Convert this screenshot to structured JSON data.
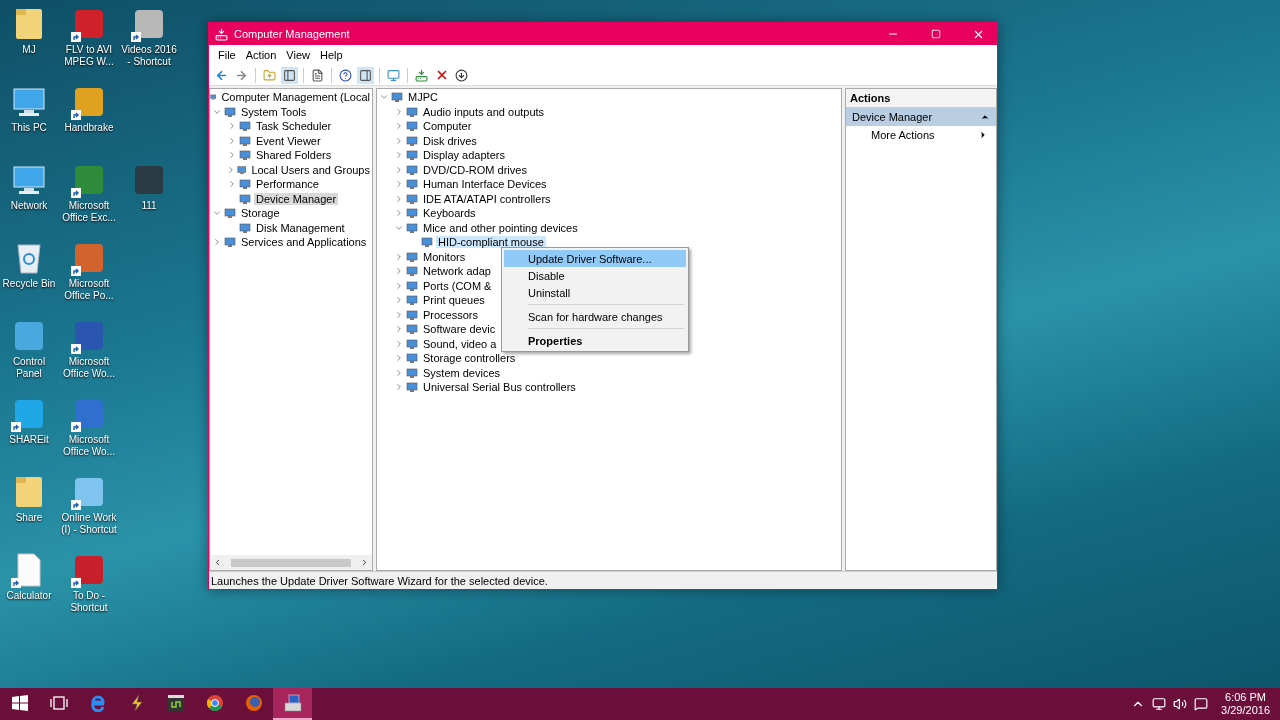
{
  "desktop": {
    "columns": [
      [
        {
          "label": "MJ",
          "kind": "folder",
          "shortcut": false
        },
        {
          "label": "This PC",
          "kind": "monitor",
          "shortcut": false
        },
        {
          "label": "Network",
          "kind": "monitor",
          "shortcut": false
        },
        {
          "label": "Recycle Bin",
          "kind": "bin",
          "shortcut": false
        },
        {
          "label": "Control Panel",
          "kind": "tile",
          "color": "#4aa8e0",
          "shortcut": false
        },
        {
          "label": "SHAREit",
          "kind": "tile",
          "color": "#1fa7e8",
          "shortcut": true
        },
        {
          "label": "Share",
          "kind": "folder",
          "shortcut": false
        },
        {
          "label": "Calculator",
          "kind": "document",
          "shortcut": true
        }
      ],
      [
        {
          "label": "FLV to AVI MPEG W...",
          "kind": "tile",
          "color": "#d0202a",
          "shortcut": true
        },
        {
          "label": "Handbrake",
          "kind": "tile",
          "color": "#e0a020",
          "shortcut": true
        },
        {
          "label": "Microsoft Office Exc...",
          "kind": "tile",
          "color": "#2e8b3a",
          "shortcut": true
        },
        {
          "label": "Microsoft Office Po...",
          "kind": "tile",
          "color": "#d2632f",
          "shortcut": true
        },
        {
          "label": "Microsoft Office Wo...",
          "kind": "tile",
          "color": "#2a56b0",
          "shortcut": true
        },
        {
          "label": "Microsoft Office Wo...",
          "kind": "tile",
          "color": "#2f6fd0",
          "shortcut": true
        },
        {
          "label": "Online Work (I) - Shortcut",
          "kind": "tile",
          "color": "#7fc4ee",
          "shortcut": true
        },
        {
          "label": "To Do - Shortcut",
          "kind": "tile",
          "color": "#c8202a",
          "shortcut": true
        }
      ],
      [
        {
          "label": "Videos 2016 - Shortcut",
          "kind": "tile",
          "color": "#b8b8b8",
          "shortcut": true
        },
        {
          "label": "111",
          "kind": "tile",
          "color": "#2b3b44",
          "shortcut": false
        }
      ]
    ]
  },
  "window": {
    "title": "Computer Management",
    "menu": [
      "File",
      "Action",
      "View",
      "Help"
    ],
    "left_tree": [
      {
        "label": "Computer Management (Local",
        "selected": false,
        "children": [
          {
            "label": "System Tools",
            "expanded": true,
            "selected": false,
            "children": [
              {
                "label": "Task Scheduler",
                "expanded": false,
                "selected": false
              },
              {
                "label": "Event Viewer",
                "expanded": false,
                "selected": false
              },
              {
                "label": "Shared Folders",
                "expanded": false,
                "selected": false
              },
              {
                "label": "Local Users and Groups",
                "expanded": false,
                "selected": false
              },
              {
                "label": "Performance",
                "expanded": false,
                "selected": false
              },
              {
                "label": "Device Manager",
                "selected": true
              }
            ]
          },
          {
            "label": "Storage",
            "expanded": true,
            "selected": false,
            "children": [
              {
                "label": "Disk Management",
                "selected": false
              }
            ]
          },
          {
            "label": "Services and Applications",
            "expanded": false,
            "selected": false
          }
        ]
      }
    ],
    "device_tree": [
      {
        "label": "MJPC",
        "expanded": true,
        "selected": false,
        "children": [
          {
            "label": "Audio inputs and outputs",
            "expanded": false,
            "selected": false
          },
          {
            "label": "Computer",
            "expanded": false,
            "selected": false
          },
          {
            "label": "Disk drives",
            "expanded": false,
            "selected": false
          },
          {
            "label": "Display adapters",
            "expanded": false,
            "selected": false
          },
          {
            "label": "DVD/CD-ROM drives",
            "expanded": false,
            "selected": false
          },
          {
            "label": "Human Interface Devices",
            "expanded": false,
            "selected": false
          },
          {
            "label": "IDE ATA/ATAPI controllers",
            "expanded": false,
            "selected": false
          },
          {
            "label": "Keyboards",
            "expanded": false,
            "selected": false
          },
          {
            "label": "Mice and other pointing devices",
            "expanded": true,
            "selected": false,
            "children": [
              {
                "label": "HID-compliant mouse",
                "selected": true
              }
            ]
          },
          {
            "label": "Monitors",
            "expanded": false,
            "selected": false
          },
          {
            "label": "Network adap",
            "expanded": false,
            "selected": false
          },
          {
            "label": "Ports (COM &",
            "expanded": false,
            "selected": false
          },
          {
            "label": "Print queues",
            "expanded": false,
            "selected": false
          },
          {
            "label": "Processors",
            "expanded": false,
            "selected": false
          },
          {
            "label": "Software devic",
            "expanded": false,
            "selected": false
          },
          {
            "label": "Sound, video a",
            "expanded": false,
            "selected": false
          },
          {
            "label": "Storage controllers",
            "expanded": false,
            "selected": false
          },
          {
            "label": "System devices",
            "expanded": false,
            "selected": false
          },
          {
            "label": "Universal Serial Bus controllers",
            "expanded": false,
            "selected": false
          }
        ]
      }
    ],
    "context_menu": [
      {
        "label": "Update Driver Software...",
        "selected": true,
        "bold": false,
        "separator_before": false
      },
      {
        "label": "Disable",
        "selected": false,
        "bold": false,
        "separator_before": false
      },
      {
        "label": "Uninstall",
        "selected": false,
        "bold": false,
        "separator_before": false
      },
      {
        "label": "Scan for hardware changes",
        "selected": false,
        "bold": false,
        "separator_before": true
      },
      {
        "label": "Properties",
        "selected": false,
        "bold": true,
        "separator_before": true
      }
    ],
    "actions": {
      "title": "Actions",
      "section": "Device Manager",
      "items": [
        "More Actions"
      ]
    },
    "status_bar": "Launches the Update Driver Software Wizard for the selected device."
  },
  "taskbar": {
    "buttons": [
      {
        "kind": "start",
        "selected": false
      },
      {
        "kind": "taskview",
        "selected": false
      },
      {
        "kind": "browser",
        "selected": false
      },
      {
        "kind": "bolt",
        "selected": false
      },
      {
        "kind": "film",
        "selected": false
      },
      {
        "kind": "ball",
        "selected": false
      },
      {
        "kind": "fox",
        "selected": false
      },
      {
        "kind": "manager",
        "selected": true
      }
    ],
    "time": "6:06 PM",
    "date": "3/29/2016"
  }
}
